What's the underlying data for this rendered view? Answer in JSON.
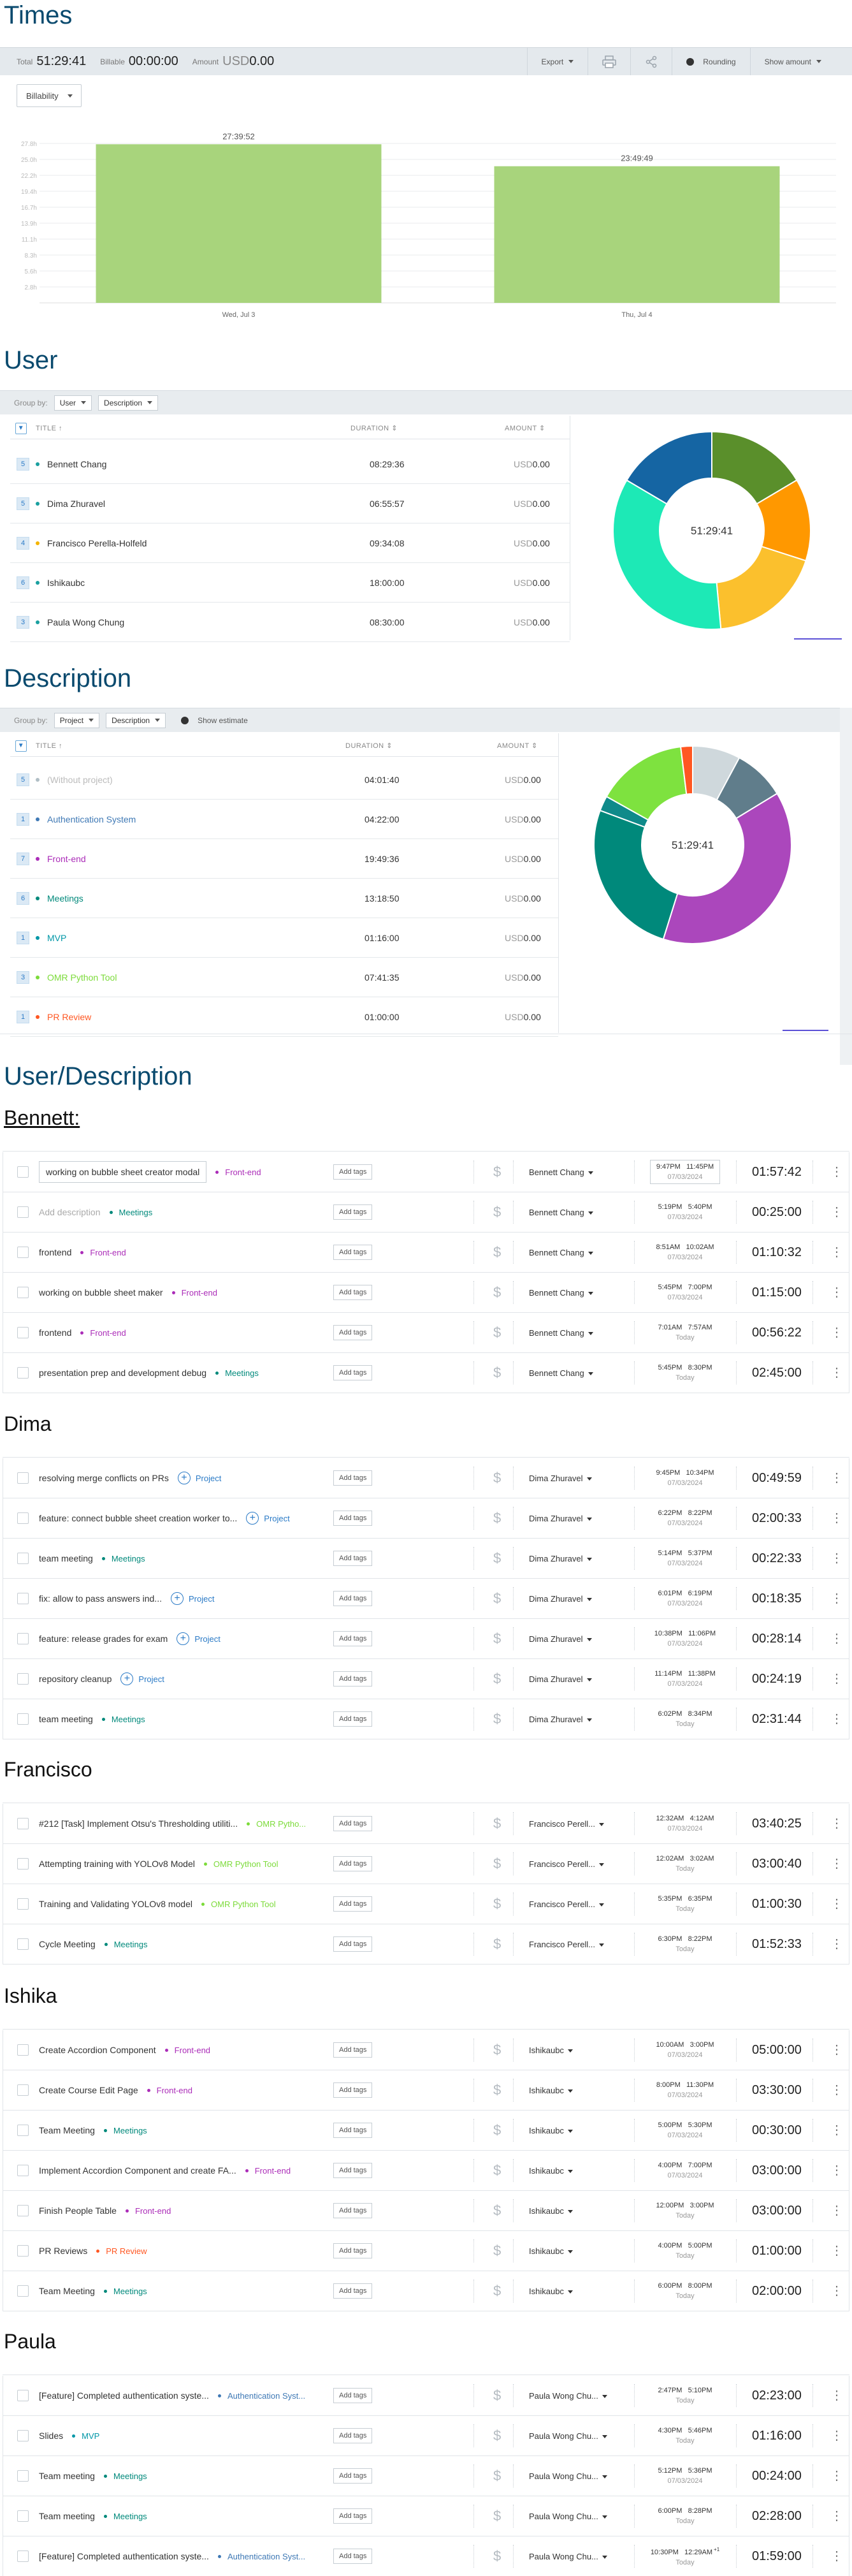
{
  "times": {
    "title": "Times",
    "summary": {
      "total_label": "Total",
      "total": "51:29:41",
      "billable_label": "Billable",
      "billable": "00:00:00",
      "amount_label": "Amount",
      "amount_currency": "USD",
      "amount": "0.00",
      "export_label": "Export",
      "rounding_label": "Rounding",
      "show_amount_label": "Show amount"
    },
    "billability_label": "Billability"
  },
  "chart_data": {
    "type": "bar",
    "categories": [
      "Wed, Jul 3",
      "Thu, Jul 4"
    ],
    "values": [
      27.66,
      23.83
    ],
    "data_labels": [
      "27:39:52",
      "23:49:49"
    ],
    "yticks": [
      "2.8h",
      "5.6h",
      "8.3h",
      "11.1h",
      "13.9h",
      "16.7h",
      "19.4h",
      "22.2h",
      "25.0h",
      "27.8h"
    ],
    "ylim": [
      0,
      27.8
    ],
    "bar_color": "#a8d47c",
    "grid": true
  },
  "user_section": {
    "title": "User",
    "group_by_label": "Group by:",
    "group1": "User",
    "group2": "Description",
    "col_title": "TITLE",
    "col_duration": "DURATION",
    "col_amount": "AMOUNT",
    "rows": [
      {
        "count": "5",
        "name": "Bennett Chang",
        "duration": "08:29:36",
        "cur": "USD",
        "amount": "0.00",
        "color": "#1aa0a0"
      },
      {
        "count": "5",
        "name": "Dima Zhuravel",
        "duration": "06:55:57",
        "cur": "USD",
        "amount": "0.00",
        "color": "#1aa0a0"
      },
      {
        "count": "4",
        "name": "Francisco Perella-Holfeld",
        "duration": "09:34:08",
        "cur": "USD",
        "amount": "0.00",
        "color": "#f4b400"
      },
      {
        "count": "6",
        "name": "Ishikaubc",
        "duration": "18:00:00",
        "cur": "USD",
        "amount": "0.00",
        "color": "#1aa0a0"
      },
      {
        "count": "3",
        "name": "Paula Wong Chung",
        "duration": "08:30:00",
        "cur": "USD",
        "amount": "0.00",
        "color": "#1aa0a0"
      }
    ],
    "donut_total": "51:29:41",
    "donut": [
      {
        "value": 8.49,
        "color": "#5a8f2b"
      },
      {
        "value": 6.93,
        "color": "#ff9800"
      },
      {
        "value": 9.57,
        "color": "#fbc02d"
      },
      {
        "value": 18.0,
        "color": "#1de9b6"
      },
      {
        "value": 8.5,
        "color": "#1565a3"
      }
    ]
  },
  "desc_section": {
    "title": "Description",
    "group_by_label": "Group by:",
    "group1": "Project",
    "group2": "Description",
    "show_estimate_label": "Show estimate",
    "col_title": "TITLE",
    "col_duration": "DURATION",
    "col_amount": "AMOUNT",
    "rows": [
      {
        "count": "5",
        "name": "(Without project)",
        "duration": "04:01:40",
        "cur": "USD",
        "amount": "0.00",
        "color": "#b0bec5",
        "muted": true
      },
      {
        "count": "1",
        "name": "Authentication System",
        "duration": "04:22:00",
        "cur": "USD",
        "amount": "0.00",
        "color": "#3f79b5"
      },
      {
        "count": "7",
        "name": "Front-end",
        "duration": "19:49:36",
        "cur": "USD",
        "amount": "0.00",
        "color": "#ab2cb8"
      },
      {
        "count": "6",
        "name": "Meetings",
        "duration": "13:18:50",
        "cur": "USD",
        "amount": "0.00",
        "color": "#00897b"
      },
      {
        "count": "1",
        "name": "MVP",
        "duration": "01:16:00",
        "cur": "USD",
        "amount": "0.00",
        "color": "#0097a7"
      },
      {
        "count": "3",
        "name": "OMR Python Tool",
        "duration": "07:41:35",
        "cur": "USD",
        "amount": "0.00",
        "color": "#7cdb3a"
      },
      {
        "count": "1",
        "name": "PR Review",
        "duration": "01:00:00",
        "cur": "USD",
        "amount": "0.00",
        "color": "#ff5722"
      }
    ],
    "donut_total": "51:29:41",
    "donut": [
      {
        "value": 4.03,
        "color": "#cfd8dc"
      },
      {
        "value": 4.37,
        "color": "#607d8b"
      },
      {
        "value": 19.83,
        "color": "#ab47bc"
      },
      {
        "value": 13.31,
        "color": "#00897b"
      },
      {
        "value": 1.27,
        "color": "#0f8a8a"
      },
      {
        "value": 7.69,
        "color": "#7ee23f"
      },
      {
        "value": 1.0,
        "color": "#ff5722"
      }
    ]
  },
  "ud_section": {
    "title": "User/Description",
    "add_tags": "Add tags",
    "groups": [
      {
        "title": "Bennett:",
        "entries": [
          {
            "desc": "working on bubble sheet creator modal",
            "desc_style": "boxed",
            "project": "Front-end",
            "pcolor": "#ab2cb8",
            "user": "Bennett Chang",
            "start": "9:47PM",
            "end": "11:45PM",
            "date": "07/03/2024",
            "times_boxed": true,
            "duration": "01:57:42"
          },
          {
            "desc": "Add description",
            "desc_style": "placeholder",
            "project": "Meetings",
            "pcolor": "#00897b",
            "user": "Bennett Chang",
            "start": "5:19PM",
            "end": "5:40PM",
            "date": "07/03/2024",
            "duration": "00:25:00"
          },
          {
            "desc": "frontend",
            "project": "Front-end",
            "pcolor": "#ab2cb8",
            "user": "Bennett Chang",
            "start": "8:51AM",
            "end": "10:02AM",
            "date": "07/03/2024",
            "duration": "01:10:32"
          },
          {
            "desc": "working on bubble sheet maker",
            "project": "Front-end",
            "pcolor": "#ab2cb8",
            "user": "Bennett Chang",
            "start": "5:45PM",
            "end": "7:00PM",
            "date": "07/03/2024",
            "duration": "01:15:00"
          },
          {
            "desc": "frontend",
            "project": "Front-end",
            "pcolor": "#ab2cb8",
            "user": "Bennett Chang",
            "start": "7:01AM",
            "end": "7:57AM",
            "date": "Today",
            "duration": "00:56:22"
          },
          {
            "desc": "presentation prep and development debug",
            "project": "Meetings",
            "pcolor": "#00897b",
            "user": "Bennett Chang",
            "start": "5:45PM",
            "end": "8:30PM",
            "date": "Today",
            "duration": "02:45:00"
          }
        ]
      },
      {
        "title": "Dima",
        "entries": [
          {
            "desc": "resolving merge conflicts on PRs",
            "project": "Project",
            "pcolor": "#2a7ac6",
            "plus": true,
            "user": "Dima Zhuravel",
            "start": "9:45PM",
            "end": "10:34PM",
            "date": "07/03/2024",
            "duration": "00:49:59"
          },
          {
            "desc": "feature: connect bubble sheet creation worker to...",
            "project": "Project",
            "pcolor": "#2a7ac6",
            "plus": true,
            "user": "Dima Zhuravel",
            "start": "6:22PM",
            "end": "8:22PM",
            "date": "07/03/2024",
            "duration": "02:00:33"
          },
          {
            "desc": "team meeting",
            "project": "Meetings",
            "pcolor": "#00897b",
            "user": "Dima Zhuravel",
            "start": "5:14PM",
            "end": "5:37PM",
            "date": "07/03/2024",
            "duration": "00:22:33"
          },
          {
            "desc": "fix: allow to pass answers ind...",
            "project": "Project",
            "pcolor": "#2a7ac6",
            "plus": true,
            "user": "Dima Zhuravel",
            "start": "6:01PM",
            "end": "6:19PM",
            "date": "07/03/2024",
            "duration": "00:18:35"
          },
          {
            "desc": "feature: release grades for exam",
            "project": "Project",
            "pcolor": "#2a7ac6",
            "plus": true,
            "user": "Dima Zhuravel",
            "start": "10:38PM",
            "end": "11:06PM",
            "date": "07/03/2024",
            "duration": "00:28:14"
          },
          {
            "desc": "repository cleanup",
            "project": "Project",
            "pcolor": "#2a7ac6",
            "plus": true,
            "user": "Dima Zhuravel",
            "start": "11:14PM",
            "end": "11:38PM",
            "date": "07/03/2024",
            "duration": "00:24:19"
          },
          {
            "desc": "team meeting",
            "project": "Meetings",
            "pcolor": "#00897b",
            "user": "Dima Zhuravel",
            "start": "6:02PM",
            "end": "8:34PM",
            "date": "Today",
            "duration": "02:31:44"
          }
        ]
      },
      {
        "title": "Francisco",
        "entries": [
          {
            "desc": "#212 [Task] Implement Otsu's Thresholding utiliti...",
            "project": "OMR Pytho...",
            "pcolor": "#7cdb3a",
            "user": "Francisco Perell...",
            "start": "12:32AM",
            "end": "4:12AM",
            "date": "07/03/2024",
            "duration": "03:40:25"
          },
          {
            "desc": "Attempting training with YOLOv8 Model",
            "project": "OMR Python Tool",
            "pcolor": "#7cdb3a",
            "user": "Francisco Perell...",
            "start": "12:02AM",
            "end": "3:02AM",
            "date": "Today",
            "duration": "03:00:40"
          },
          {
            "desc": "Training and Validating YOLOv8 model",
            "project": "OMR Python Tool",
            "pcolor": "#7cdb3a",
            "user": "Francisco Perell...",
            "start": "5:35PM",
            "end": "6:35PM",
            "date": "Today",
            "duration": "01:00:30"
          },
          {
            "desc": "Cycle Meeting",
            "project": "Meetings",
            "pcolor": "#00897b",
            "user": "Francisco Perell...",
            "start": "6:30PM",
            "end": "8:22PM",
            "date": "Today",
            "duration": "01:52:33"
          }
        ]
      },
      {
        "title": "Ishika",
        "entries": [
          {
            "desc": "Create Accordion Component",
            "project": "Front-end",
            "pcolor": "#ab2cb8",
            "user": "Ishikaubc",
            "start": "10:00AM",
            "end": "3:00PM",
            "date": "07/03/2024",
            "duration": "05:00:00"
          },
          {
            "desc": "Create Course Edit Page",
            "project": "Front-end",
            "pcolor": "#ab2cb8",
            "user": "Ishikaubc",
            "start": "8:00PM",
            "end": "11:30PM",
            "date": "07/03/2024",
            "duration": "03:30:00"
          },
          {
            "desc": "Team Meeting",
            "project": "Meetings",
            "pcolor": "#00897b",
            "user": "Ishikaubc",
            "start": "5:00PM",
            "end": "5:30PM",
            "date": "07/03/2024",
            "duration": "00:30:00"
          },
          {
            "desc": "Implement Accordion Component and create FA...",
            "project": "Front-end",
            "pcolor": "#ab2cb8",
            "user": "Ishikaubc",
            "start": "4:00PM",
            "end": "7:00PM",
            "date": "07/03/2024",
            "duration": "03:00:00"
          },
          {
            "desc": "Finish People Table",
            "project": "Front-end",
            "pcolor": "#ab2cb8",
            "user": "Ishikaubc",
            "start": "12:00PM",
            "end": "3:00PM",
            "date": "Today",
            "duration": "03:00:00"
          },
          {
            "desc": "PR Reviews",
            "project": "PR Review",
            "pcolor": "#ff5722",
            "user": "Ishikaubc",
            "start": "4:00PM",
            "end": "5:00PM",
            "date": "Today",
            "duration": "01:00:00"
          },
          {
            "desc": "Team Meeting",
            "project": "Meetings",
            "pcolor": "#00897b",
            "user": "Ishikaubc",
            "start": "6:00PM",
            "end": "8:00PM",
            "date": "Today",
            "duration": "02:00:00"
          }
        ]
      },
      {
        "title": "Paula",
        "entries": [
          {
            "desc": "[Feature] Completed authentication syste...",
            "project": "Authentication Syst...",
            "pcolor": "#3f79b5",
            "user": "Paula Wong Chu...",
            "start": "2:47PM",
            "end": "5:10PM",
            "date": "Today",
            "duration": "02:23:00"
          },
          {
            "desc": "Slides",
            "project": "MVP",
            "pcolor": "#0097a7",
            "user": "Paula Wong Chu...",
            "start": "4:30PM",
            "end": "5:46PM",
            "date": "Today",
            "duration": "01:16:00"
          },
          {
            "desc": "Team meeting",
            "project": "Meetings",
            "pcolor": "#00897b",
            "user": "Paula Wong Chu...",
            "start": "5:12PM",
            "end": "5:36PM",
            "date": "07/03/2024",
            "duration": "00:24:00"
          },
          {
            "desc": "Team meeting",
            "project": "Meetings",
            "pcolor": "#00897b",
            "user": "Paula Wong Chu...",
            "start": "6:00PM",
            "end": "8:28PM",
            "date": "Today",
            "duration": "02:28:00"
          },
          {
            "desc": "[Feature] Completed authentication syste...",
            "project": "Authentication Syst...",
            "pcolor": "#3f79b5",
            "user": "Paula Wong Chu...",
            "start": "10:30PM",
            "end": "12:29AM",
            "date": "Today",
            "sup": "+1",
            "duration": "01:59:00"
          }
        ]
      }
    ]
  }
}
